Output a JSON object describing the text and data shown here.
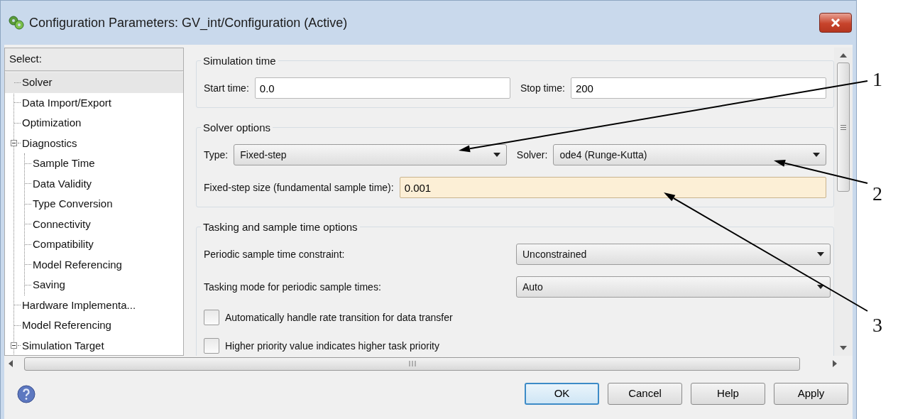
{
  "window": {
    "title": "Configuration Parameters: GV_int/Configuration (Active)"
  },
  "tree": {
    "header": "Select:",
    "items": [
      {
        "label": "Solver",
        "selected": true
      },
      {
        "label": "Data Import/Export",
        "selected": false
      },
      {
        "label": "Optimization",
        "selected": false
      },
      {
        "label": "Diagnostics",
        "selected": false,
        "expanded": true,
        "children": [
          {
            "label": "Sample Time",
            "selected": false
          },
          {
            "label": "Data Validity",
            "selected": false
          },
          {
            "label": "Type Conversion",
            "selected": false
          },
          {
            "label": "Connectivity",
            "selected": false
          },
          {
            "label": "Compatibility",
            "selected": false
          },
          {
            "label": "Model Referencing",
            "selected": false
          },
          {
            "label": "Saving",
            "selected": false
          }
        ]
      },
      {
        "label": "Hardware Implementa...",
        "selected": false
      },
      {
        "label": "Model Referencing",
        "selected": false
      },
      {
        "label": "Simulation Target",
        "selected": false,
        "expanded": true
      }
    ]
  },
  "sections": [
    {
      "title": "Simulation time",
      "rows": [
        {
          "kind": "inline",
          "fields": [
            {
              "label": "Start time:",
              "kind": "text",
              "value": "0.0",
              "highlighted": false
            },
            {
              "label": "Stop time:",
              "kind": "text",
              "value": "200",
              "highlighted": false
            }
          ]
        }
      ]
    },
    {
      "title": "Solver options",
      "rows": [
        {
          "kind": "inline",
          "fields": [
            {
              "label": "Type:",
              "kind": "dropdown",
              "value": "Fixed-step"
            },
            {
              "label": "Solver:",
              "kind": "dropdown",
              "value": "ode4 (Runge-Kutta)"
            }
          ]
        },
        {
          "kind": "inline",
          "fields": [
            {
              "label": "Fixed-step size (fundamental sample time):",
              "kind": "text",
              "value": "0.001",
              "highlighted": true
            }
          ]
        }
      ]
    },
    {
      "title": "Tasking and sample time options",
      "rows": [
        {
          "kind": "wide",
          "label": "Periodic sample time constraint:",
          "value": "Unconstrained"
        },
        {
          "kind": "wide",
          "label": "Tasking mode for periodic sample times:",
          "value": "Auto"
        },
        {
          "kind": "checkbox",
          "label": "Automatically handle rate transition for data transfer",
          "checked": false
        },
        {
          "kind": "checkbox",
          "label": "Higher priority value indicates higher task priority",
          "checked": false
        }
      ]
    }
  ],
  "buttons": [
    {
      "label": "OK",
      "default": true
    },
    {
      "label": "Cancel",
      "default": false
    },
    {
      "label": "Help",
      "default": false
    },
    {
      "label": "Apply",
      "default": false
    }
  ],
  "annotations": [
    {
      "label": "1"
    },
    {
      "label": "2"
    },
    {
      "label": "3"
    }
  ]
}
